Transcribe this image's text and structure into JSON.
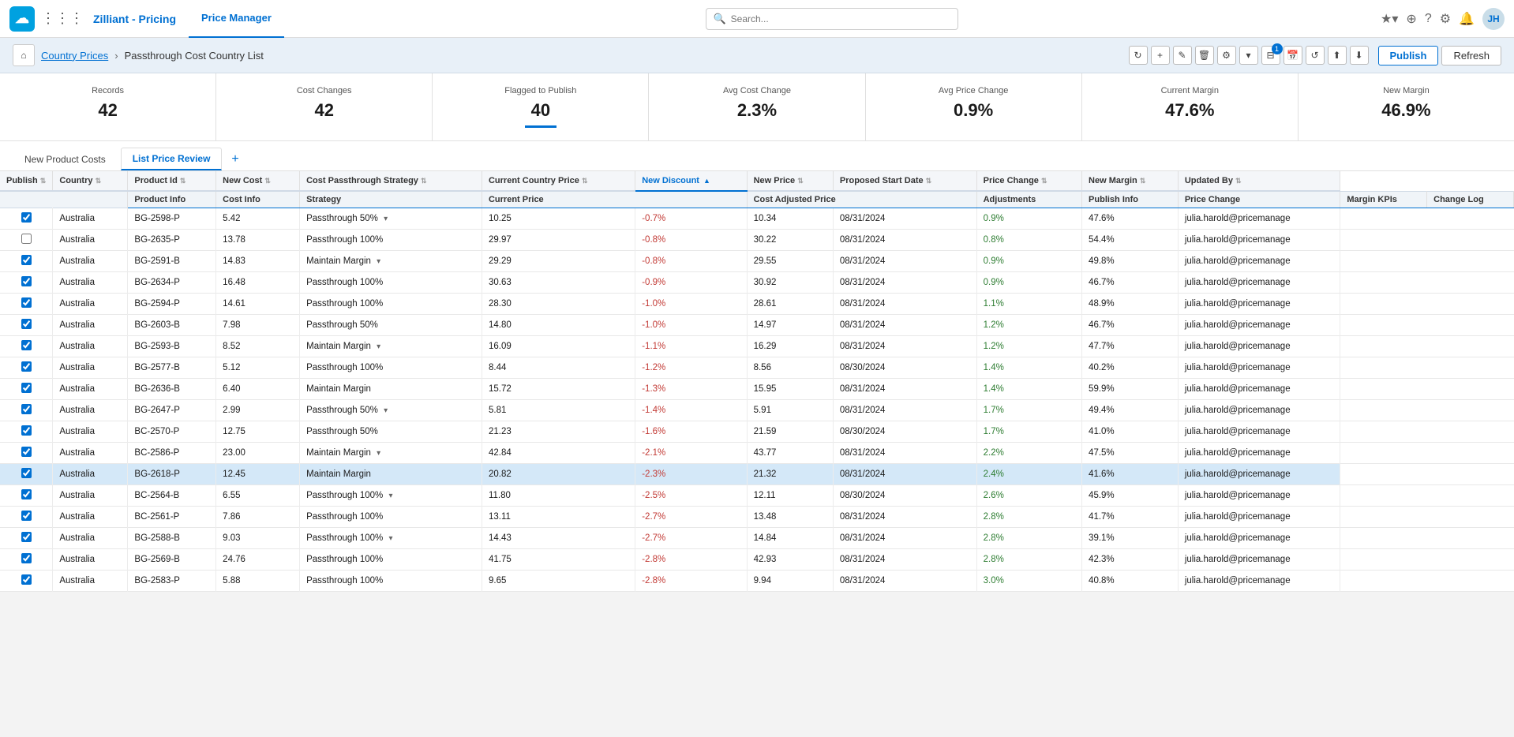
{
  "app": {
    "logo": "☁",
    "name": "Zilliant - Pricing",
    "tab": "Price Manager",
    "search_placeholder": "Search..."
  },
  "breadcrumb": {
    "home": "⌂",
    "parent": "Country Prices",
    "separator": "›",
    "current": "Passthrough Cost Country List"
  },
  "toolbar": {
    "refresh_icon": "↻",
    "plus_icon": "+",
    "edit_icon": "✎",
    "delete_icon": "🗑",
    "settings_icon": "⚙",
    "dropdown_icon": "▾",
    "filter_icon": "⊟",
    "filter_count": "1",
    "calendar_icon": "📅",
    "reset_icon": "↺",
    "upload_icon": "⬆",
    "download_icon": "⬇",
    "publish_label": "Publish",
    "refresh_label": "Refresh"
  },
  "stats": [
    {
      "label": "Records",
      "value": "42"
    },
    {
      "label": "Cost Changes",
      "value": "42"
    },
    {
      "label": "Flagged to Publish",
      "value": "40"
    },
    {
      "label": "Avg Cost Change",
      "value": "2.3%"
    },
    {
      "label": "Avg Price Change",
      "value": "0.9%"
    },
    {
      "label": "Current Margin",
      "value": "47.6%"
    },
    {
      "label": "New Margin",
      "value": "46.9%"
    }
  ],
  "tabs": [
    {
      "label": "New Product Costs",
      "active": false
    },
    {
      "label": "List Price Review",
      "active": true
    }
  ],
  "column_groups": [
    {
      "label": "",
      "colspan": 4
    },
    {
      "label": "Product Info",
      "colspan": 2
    },
    {
      "label": "Cost Info",
      "colspan": 2
    },
    {
      "label": "Strategy",
      "colspan": 2
    },
    {
      "label": "Current Price",
      "colspan": 2
    },
    {
      "label": "Cost Adjusted Price",
      "colspan": 2
    },
    {
      "label": "Adjustments",
      "colspan": 2
    },
    {
      "label": "Publish Info",
      "colspan": 2
    },
    {
      "label": "Price Change",
      "colspan": 2
    },
    {
      "label": "Margin KPIs",
      "colspan": 2
    },
    {
      "label": "Change Log",
      "colspan": 2
    }
  ],
  "columns": [
    {
      "key": "publish",
      "label": "Publish",
      "sortable": true,
      "sorted": false
    },
    {
      "key": "country",
      "label": "Country",
      "sortable": true,
      "sorted": false
    },
    {
      "key": "product_id",
      "label": "Product Id",
      "sortable": true,
      "sorted": false
    },
    {
      "key": "new_cost",
      "label": "New Cost",
      "sortable": true,
      "sorted": false
    },
    {
      "key": "strategy",
      "label": "Cost Passthrough Strategy",
      "sortable": true,
      "sorted": false
    },
    {
      "key": "current_country_price",
      "label": "Current Country Price",
      "sortable": true,
      "sorted": false
    },
    {
      "key": "new_discount",
      "label": "New Discount",
      "sortable": true,
      "sorted": true
    },
    {
      "key": "new_price",
      "label": "New Price",
      "sortable": true,
      "sorted": false
    },
    {
      "key": "proposed_start_date",
      "label": "Proposed Start Date",
      "sortable": true,
      "sorted": false
    },
    {
      "key": "price_change",
      "label": "Price Change",
      "sortable": true,
      "sorted": false
    },
    {
      "key": "new_margin",
      "label": "New Margin",
      "sortable": true,
      "sorted": false
    },
    {
      "key": "updated_by",
      "label": "Updated By",
      "sortable": true,
      "sorted": false
    }
  ],
  "rows": [
    {
      "publish": true,
      "highlighted": false,
      "country": "Australia",
      "product_id": "BG-2598-P",
      "new_cost": "5.42",
      "strategy": "Passthrough 50%",
      "has_arrow": true,
      "current_country_price": "10.25",
      "new_discount": "-0.7%",
      "new_price": "10.34",
      "proposed_start_date": "08/31/2024",
      "price_change": "0.9%",
      "new_margin": "47.6%",
      "updated_by": "julia.harold@pricemanage"
    },
    {
      "publish": false,
      "highlighted": false,
      "country": "Australia",
      "product_id": "BG-2635-P",
      "new_cost": "13.78",
      "strategy": "Passthrough 100%",
      "has_arrow": false,
      "current_country_price": "29.97",
      "new_discount": "-0.8%",
      "new_price": "30.22",
      "proposed_start_date": "08/31/2024",
      "price_change": "0.8%",
      "new_margin": "54.4%",
      "updated_by": "julia.harold@pricemanage"
    },
    {
      "publish": true,
      "highlighted": false,
      "country": "Australia",
      "product_id": "BG-2591-B",
      "new_cost": "14.83",
      "strategy": "Maintain Margin",
      "has_arrow": true,
      "current_country_price": "29.29",
      "new_discount": "-0.8%",
      "new_price": "29.55",
      "proposed_start_date": "08/31/2024",
      "price_change": "0.9%",
      "new_margin": "49.8%",
      "updated_by": "julia.harold@pricemanage"
    },
    {
      "publish": true,
      "highlighted": false,
      "country": "Australia",
      "product_id": "BG-2634-P",
      "new_cost": "16.48",
      "strategy": "Passthrough 100%",
      "has_arrow": false,
      "current_country_price": "30.63",
      "new_discount": "-0.9%",
      "new_price": "30.92",
      "proposed_start_date": "08/31/2024",
      "price_change": "0.9%",
      "new_margin": "46.7%",
      "updated_by": "julia.harold@pricemanage"
    },
    {
      "publish": true,
      "highlighted": false,
      "country": "Australia",
      "product_id": "BG-2594-P",
      "new_cost": "14.61",
      "strategy": "Passthrough 100%",
      "has_arrow": false,
      "current_country_price": "28.30",
      "new_discount": "-1.0%",
      "new_price": "28.61",
      "proposed_start_date": "08/31/2024",
      "price_change": "1.1%",
      "new_margin": "48.9%",
      "updated_by": "julia.harold@pricemanage"
    },
    {
      "publish": true,
      "highlighted": false,
      "country": "Australia",
      "product_id": "BG-2603-B",
      "new_cost": "7.98",
      "strategy": "Passthrough 50%",
      "has_arrow": false,
      "current_country_price": "14.80",
      "new_discount": "-1.0%",
      "new_price": "14.97",
      "proposed_start_date": "08/31/2024",
      "price_change": "1.2%",
      "new_margin": "46.7%",
      "updated_by": "julia.harold@pricemanage"
    },
    {
      "publish": true,
      "highlighted": false,
      "country": "Australia",
      "product_id": "BG-2593-B",
      "new_cost": "8.52",
      "strategy": "Maintain Margin",
      "has_arrow": true,
      "current_country_price": "16.09",
      "new_discount": "-1.1%",
      "new_price": "16.29",
      "proposed_start_date": "08/31/2024",
      "price_change": "1.2%",
      "new_margin": "47.7%",
      "updated_by": "julia.harold@pricemanage"
    },
    {
      "publish": true,
      "highlighted": false,
      "country": "Australia",
      "product_id": "BG-2577-B",
      "new_cost": "5.12",
      "strategy": "Passthrough 100%",
      "has_arrow": false,
      "current_country_price": "8.44",
      "new_discount": "-1.2%",
      "new_price": "8.56",
      "proposed_start_date": "08/30/2024",
      "price_change": "1.4%",
      "new_margin": "40.2%",
      "updated_by": "julia.harold@pricemanage"
    },
    {
      "publish": true,
      "highlighted": false,
      "country": "Australia",
      "product_id": "BG-2636-B",
      "new_cost": "6.40",
      "strategy": "Maintain Margin",
      "has_arrow": false,
      "current_country_price": "15.72",
      "new_discount": "-1.3%",
      "new_price": "15.95",
      "proposed_start_date": "08/31/2024",
      "price_change": "1.4%",
      "new_margin": "59.9%",
      "updated_by": "julia.harold@pricemanage"
    },
    {
      "publish": true,
      "highlighted": false,
      "country": "Australia",
      "product_id": "BG-2647-P",
      "new_cost": "2.99",
      "strategy": "Passthrough 50%",
      "has_arrow": true,
      "current_country_price": "5.81",
      "new_discount": "-1.4%",
      "new_price": "5.91",
      "proposed_start_date": "08/31/2024",
      "price_change": "1.7%",
      "new_margin": "49.4%",
      "updated_by": "julia.harold@pricemanage"
    },
    {
      "publish": true,
      "highlighted": false,
      "country": "Australia",
      "product_id": "BC-2570-P",
      "new_cost": "12.75",
      "strategy": "Passthrough 50%",
      "has_arrow": false,
      "current_country_price": "21.23",
      "new_discount": "-1.6%",
      "new_price": "21.59",
      "proposed_start_date": "08/30/2024",
      "price_change": "1.7%",
      "new_margin": "41.0%",
      "updated_by": "julia.harold@pricemanage"
    },
    {
      "publish": true,
      "highlighted": false,
      "country": "Australia",
      "product_id": "BC-2586-P",
      "new_cost": "23.00",
      "strategy": "Maintain Margin",
      "has_arrow": true,
      "current_country_price": "42.84",
      "new_discount": "-2.1%",
      "new_price": "43.77",
      "proposed_start_date": "08/31/2024",
      "price_change": "2.2%",
      "new_margin": "47.5%",
      "updated_by": "julia.harold@pricemanage"
    },
    {
      "publish": true,
      "highlighted": true,
      "country": "Australia",
      "product_id": "BG-2618-P",
      "new_cost": "12.45",
      "strategy": "Maintain Margin",
      "has_arrow": false,
      "current_country_price": "20.82",
      "new_discount": "-2.3%",
      "new_price": "21.32",
      "proposed_start_date": "08/31/2024",
      "price_change": "2.4%",
      "new_margin": "41.6%",
      "updated_by": "julia.harold@pricemanage"
    },
    {
      "publish": true,
      "highlighted": false,
      "country": "Australia",
      "product_id": "BC-2564-B",
      "new_cost": "6.55",
      "strategy": "Passthrough 100%",
      "has_arrow": true,
      "current_country_price": "11.80",
      "new_discount": "-2.5%",
      "new_price": "12.11",
      "proposed_start_date": "08/30/2024",
      "price_change": "2.6%",
      "new_margin": "45.9%",
      "updated_by": "julia.harold@pricemanage"
    },
    {
      "publish": true,
      "highlighted": false,
      "country": "Australia",
      "product_id": "BC-2561-P",
      "new_cost": "7.86",
      "strategy": "Passthrough 100%",
      "has_arrow": false,
      "current_country_price": "13.11",
      "new_discount": "-2.7%",
      "new_price": "13.48",
      "proposed_start_date": "08/31/2024",
      "price_change": "2.8%",
      "new_margin": "41.7%",
      "updated_by": "julia.harold@pricemanage"
    },
    {
      "publish": true,
      "highlighted": false,
      "country": "Australia",
      "product_id": "BG-2588-B",
      "new_cost": "9.03",
      "strategy": "Passthrough 100%",
      "has_arrow": true,
      "current_country_price": "14.43",
      "new_discount": "-2.7%",
      "new_price": "14.84",
      "proposed_start_date": "08/31/2024",
      "price_change": "2.8%",
      "new_margin": "39.1%",
      "updated_by": "julia.harold@pricemanage"
    },
    {
      "publish": true,
      "highlighted": false,
      "country": "Australia",
      "product_id": "BG-2569-B",
      "new_cost": "24.76",
      "strategy": "Passthrough 100%",
      "has_arrow": false,
      "current_country_price": "41.75",
      "new_discount": "-2.8%",
      "new_price": "42.93",
      "proposed_start_date": "08/31/2024",
      "price_change": "2.8%",
      "new_margin": "42.3%",
      "updated_by": "julia.harold@pricemanage"
    },
    {
      "publish": true,
      "highlighted": false,
      "country": "Australia",
      "product_id": "BG-2583-P",
      "new_cost": "5.88",
      "strategy": "Passthrough 100%",
      "has_arrow": false,
      "current_country_price": "9.65",
      "new_discount": "-2.8%",
      "new_price": "9.94",
      "proposed_start_date": "08/31/2024",
      "price_change": "3.0%",
      "new_margin": "40.8%",
      "updated_by": "julia.harold@pricemanage"
    }
  ]
}
